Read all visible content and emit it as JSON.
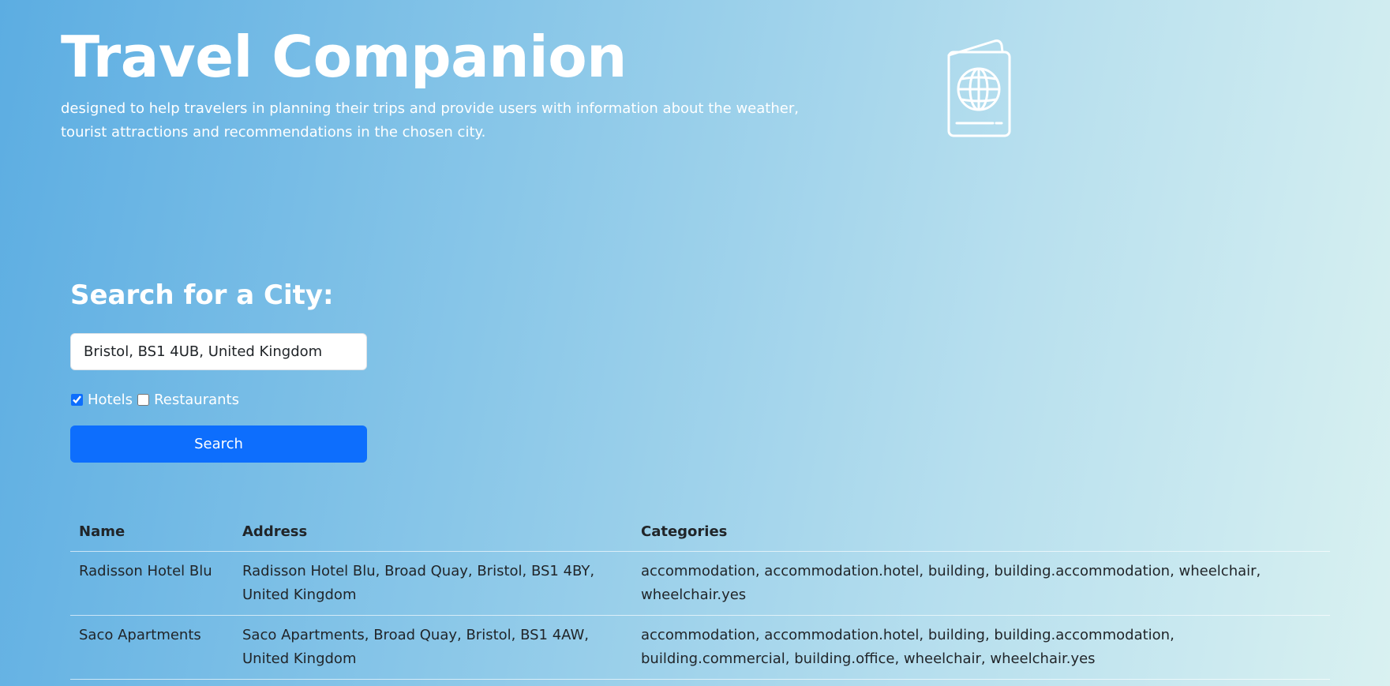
{
  "header": {
    "title": "Travel Companion",
    "subtitle": "designed to help travelers in planning their trips and provide users with information about the weather, tourist attractions and recommendations in the chosen city.",
    "logo_icon": "passport-icon"
  },
  "search": {
    "heading": "Search for a City:",
    "input_value": "Bristol, BS1 4UB, United Kingdom",
    "filters": [
      {
        "label": "Hotels",
        "checked": true
      },
      {
        "label": "Restaurants",
        "checked": false
      }
    ],
    "button_label": "Search",
    "button_color": "#0d6efd"
  },
  "results": {
    "columns": [
      "Name",
      "Address",
      "Categories"
    ],
    "rows": [
      {
        "name": "Radisson Hotel Blu",
        "address": "Radisson Hotel Blu, Broad Quay, Bristol, BS1 4BY, United Kingdom",
        "categories": "accommodation, accommodation.hotel, building, building.accommodation, wheelchair, wheelchair.yes"
      },
      {
        "name": "Saco Apartments",
        "address": "Saco Apartments, Broad Quay, Bristol, BS1 4AW, United Kingdom",
        "categories": "accommodation, accommodation.hotel, building, building.accommodation, building.commercial, building.office, wheelchair, wheelchair.yes"
      }
    ]
  }
}
